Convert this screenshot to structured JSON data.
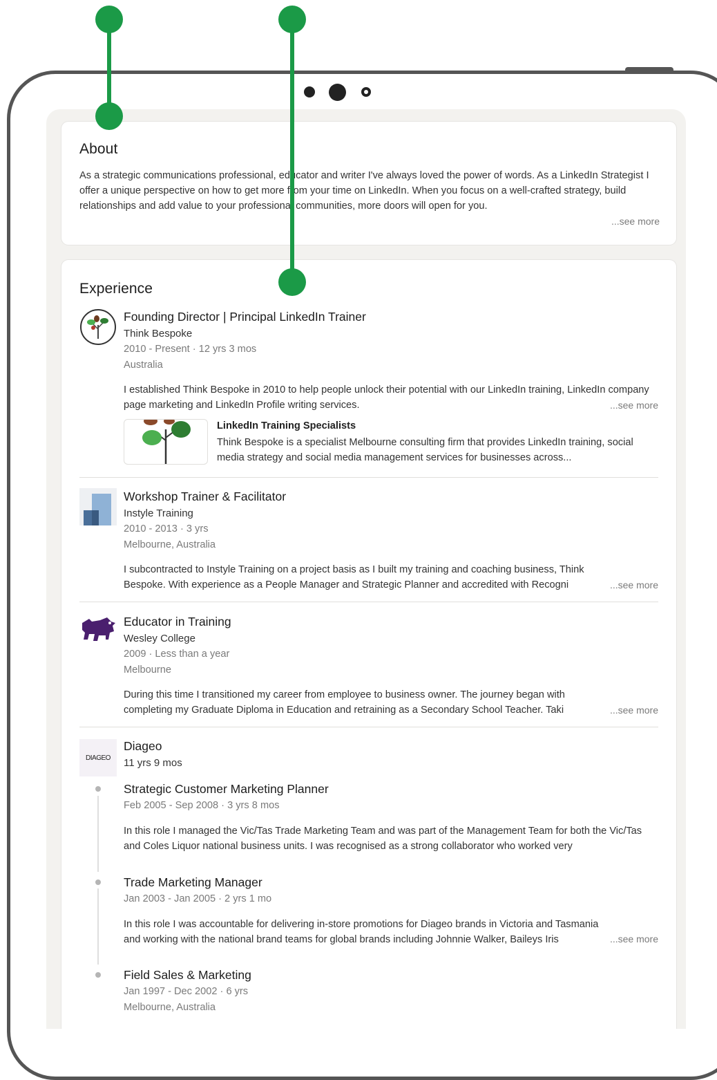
{
  "about": {
    "heading": "About",
    "text": "As a strategic communications professional, educator and writer I've always loved the power of words. As a LinkedIn Strategist I offer a unique perspective on how to get more from your time on LinkedIn. When you focus on a well-crafted strategy, build relationships and add value to your professional communities, more doors will open for you.",
    "see_more": "...see more"
  },
  "experience": {
    "heading": "Experience",
    "items": [
      {
        "title": "Founding Director | Principal LinkedIn Trainer",
        "company": "Think Bespoke",
        "dates": "2010 - Present · 12 yrs 3 mos",
        "location": "Australia",
        "description": "I established Think Bespoke in 2010 to help people unlock their potential with our LinkedIn training, LinkedIn company page marketing and LinkedIn Profile writing services.",
        "see_more": "...see more",
        "media": {
          "title": "LinkedIn Training Specialists",
          "description": "Think Bespoke is a specialist Melbourne consulting firm that provides LinkedIn training, social media strategy and social media management services for businesses across..."
        }
      },
      {
        "title": "Workshop Trainer & Facilitator",
        "company": "Instyle Training",
        "dates": "2010 - 2013 · 3 yrs",
        "location": "Melbourne, Australia",
        "description": "I subcontracted to Instyle Training on a project basis as I built my training and coaching business, Think Bespoke. With experience as a People Manager and Strategic Planner and accredited with Recogni",
        "see_more": "...see more"
      },
      {
        "title": "Educator in Training",
        "company": "Wesley College",
        "dates": "2009 · Less than a year",
        "location": "Melbourne",
        "description": "During this time I transitioned my career from employee to business owner. The journey began with completing my Graduate Diploma in Education and retraining as a Secondary School Teacher. Taki",
        "see_more": "...see more"
      },
      {
        "company": "Diageo",
        "logo_text": "DIAGEO",
        "duration": "11 yrs 9 mos",
        "roles": [
          {
            "title": "Strategic Customer Marketing Planner",
            "dates": "Feb 2005 - Sep 2008 · 3 yrs 8 mos",
            "description": "In this role I managed the Vic/Tas Trade Marketing Team and was part of the Management Team for both the Vic/Tas and Coles Liquor national business units. I was recognised as a strong collaborator who worked very"
          },
          {
            "title": "Trade Marketing Manager",
            "dates": "Jan 2003 - Jan 2005 · 2 yrs 1 mo",
            "description": "In this role I was accountable for delivering in-store promotions for Diageo brands in Victoria and Tasmania and working with the national brand teams for global brands including Johnnie Walker, Baileys Iris",
            "see_more": "...see more"
          },
          {
            "title": "Field Sales & Marketing",
            "dates": "Jan 1997 - Dec 2002 · 6 yrs",
            "location": "Melbourne, Australia"
          }
        ]
      }
    ]
  },
  "colors": {
    "annotation": "#1b9a47",
    "device_frame": "#555555",
    "screen_bg": "#f3f2ef"
  }
}
